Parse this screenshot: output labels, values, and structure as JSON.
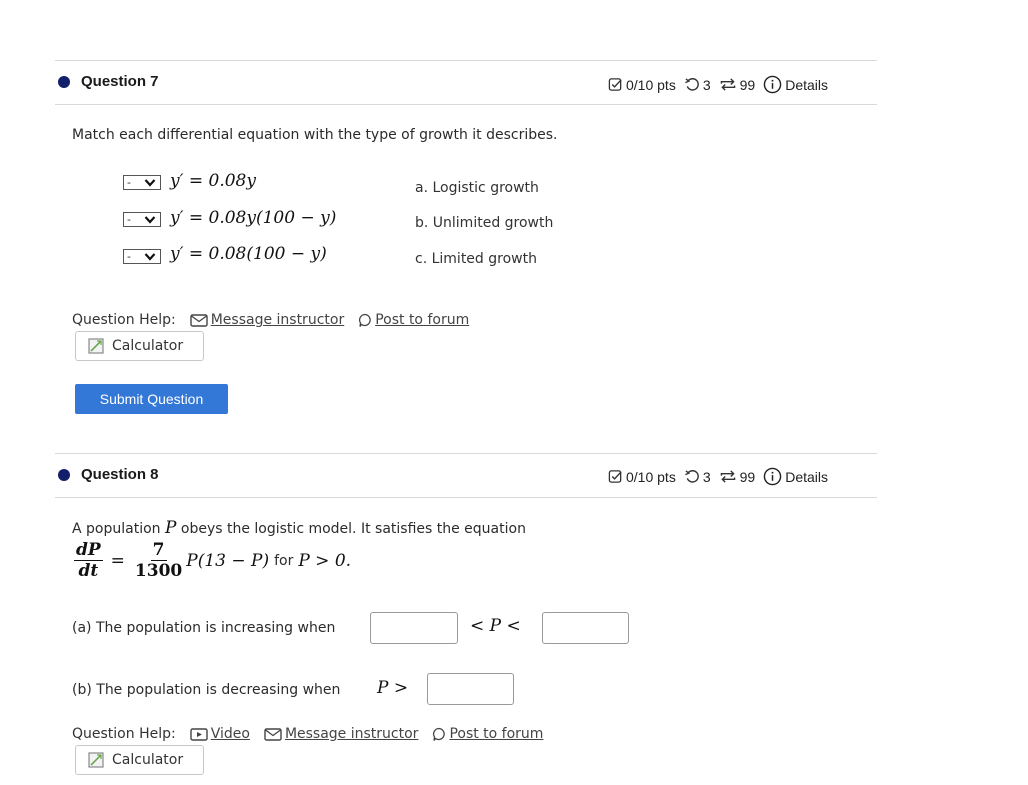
{
  "questions": [
    {
      "title": "Question 7",
      "meta": {
        "points": "0/10 pts",
        "attempts": "3",
        "retries": "99",
        "details": "Details"
      },
      "prompt": "Match each differential equation with the type of growth it describes.",
      "matching": [
        {
          "selected": "-",
          "equation": "y′ = 0.08y"
        },
        {
          "selected": "-",
          "equation": "y′ = 0.08y(100 − y)"
        },
        {
          "selected": "-",
          "equation": "y′ = 0.08(100 − y)"
        }
      ],
      "choices": [
        "a. Logistic growth",
        "b. Unlimited growth",
        "c. Limited growth"
      ],
      "help": {
        "label": "Question Help:",
        "links": [
          "Message instructor",
          "Post to forum"
        ]
      },
      "calculator": "Calculator",
      "submit": "Submit Question"
    },
    {
      "title": "Question 8",
      "meta": {
        "points": "0/10 pts",
        "attempts": "3",
        "retries": "99",
        "details": "Details"
      },
      "prompt": {
        "pre": "A population",
        "var": "P",
        "post": "obeys the logistic model. It satisfies the equation",
        "frac1_num": "dP",
        "frac1_den": "dt",
        "eq": "=",
        "frac2_num": "7",
        "frac2_den": "1300",
        "rhs": "P(13 − P)",
        "for_text": "for",
        "condition": "P > 0."
      },
      "part_a": {
        "text": "(a) The population is increasing when",
        "between": "< P <",
        "value1": "",
        "value2": ""
      },
      "part_b": {
        "text": "(b) The population is decreasing when",
        "math": "P >",
        "value": ""
      },
      "help": {
        "label": "Question Help:",
        "links": [
          "Video",
          "Message instructor",
          "Post to forum"
        ]
      },
      "calculator": "Calculator"
    }
  ],
  "colors": {
    "accent": "#3378d7",
    "bullet": "#131f6b"
  },
  "icons": {
    "points": "check-square-icon",
    "attempts": "undo-icon",
    "retries": "repeat-icon",
    "details": "info-circle-icon",
    "message": "envelope-icon",
    "forum": "speech-bubble-icon",
    "video": "video-icon",
    "calculator": "calculator-icon",
    "dropdown": "chevron-down-icon"
  }
}
